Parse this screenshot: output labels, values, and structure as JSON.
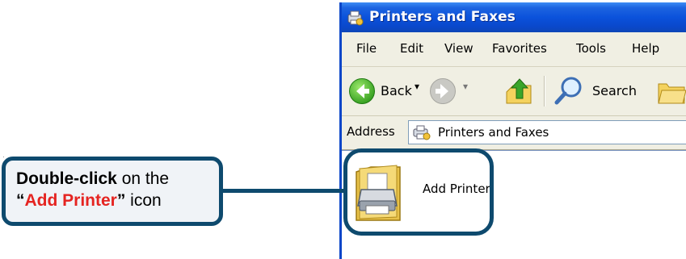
{
  "window": {
    "title": "Printers and Faxes",
    "menu": [
      "File",
      "Edit",
      "View",
      "Favorites",
      "Tools",
      "Help"
    ],
    "toolbar": {
      "back_label": "Back",
      "search_label": "Search"
    },
    "address": {
      "label": "Address",
      "value": "Printers and Faxes"
    },
    "items": [
      {
        "label": "Add Printer",
        "icon": "add-printer-icon"
      }
    ]
  },
  "callout": {
    "part1": "Double-click",
    "part2": " on the ",
    "part3": "“",
    "part4": "Add Printer",
    "part5": "”",
    "part6": " icon"
  },
  "colors": {
    "titlebar": "#0a52db",
    "callout_border": "#0e4a6e",
    "callout_highlight": "#e52421",
    "chrome": "#f0efe3"
  }
}
